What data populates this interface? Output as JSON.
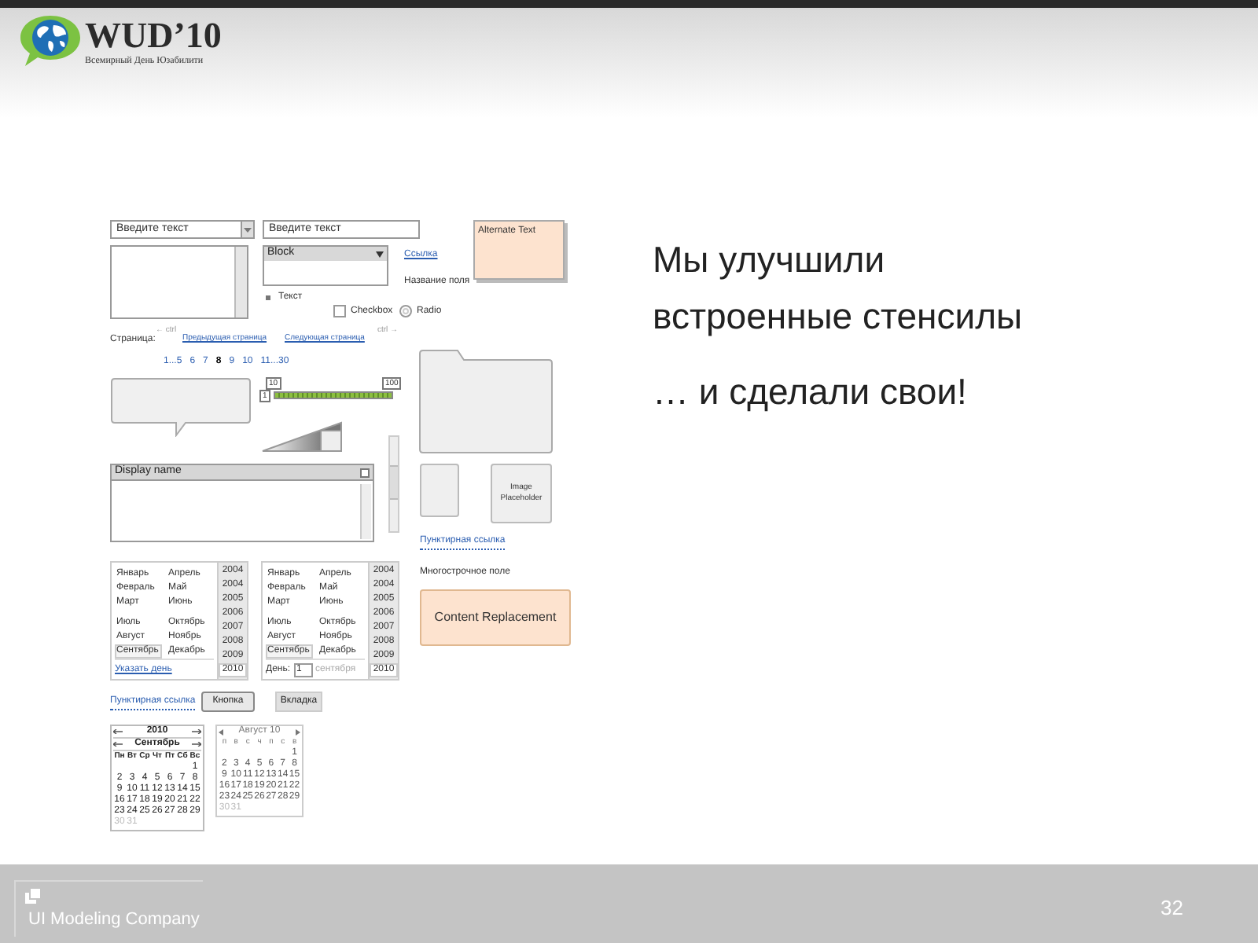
{
  "header": {
    "logo_title": "WUD’10",
    "logo_subtitle": "Всемирный День Юзабилити"
  },
  "slide": {
    "heading_lines": [
      "Мы улучшили",
      "встроенные стенсилы"
    ],
    "tagline": "… и сделали свои!"
  },
  "stencils": {
    "combo": {
      "value": "Введите текст"
    },
    "textbox": {
      "value": "Введите текст"
    },
    "note": "Alternate Text",
    "dropdown": {
      "value": "Block"
    },
    "link": "Ссылка",
    "field_label": "Название поля",
    "bullet": "Текст",
    "checkbox": {
      "label": "Checkbox",
      "checked": false
    },
    "radio": {
      "label": "Radio",
      "selected": false
    },
    "pager": {
      "label": "Страница:",
      "prev_hint": "← ctrl",
      "prev": "Предыдущая страница",
      "next": "Следующая страница",
      "next_hint": "ctrl →",
      "pages": [
        {
          "label": "1...5",
          "selected": false
        },
        {
          "label": "6",
          "selected": false
        },
        {
          "label": "7",
          "selected": false
        },
        {
          "label": "8",
          "selected": true
        },
        {
          "label": "9",
          "selected": false
        },
        {
          "label": "10",
          "selected": false
        },
        {
          "label": "11...30",
          "selected": false
        }
      ]
    },
    "slider": {
      "min": "10",
      "max": "100",
      "value_label": "1",
      "level": 1
    },
    "panel": {
      "title": "Display name"
    },
    "image_placeholder": "Image Placeholder",
    "dotted_link_1": "Пунктирная ссылка",
    "month_pickers": [
      {
        "months": [
          {
            "label": "Январь",
            "selected": false
          },
          {
            "label": "Апрель",
            "selected": false
          },
          {
            "label": "Февраль",
            "selected": false
          },
          {
            "label": "Май",
            "selected": false
          },
          {
            "label": "Март",
            "selected": false
          },
          {
            "label": "Июнь",
            "selected": false
          },
          {
            "label": "Июль",
            "selected": false
          },
          {
            "label": "Октябрь",
            "selected": false
          },
          {
            "label": "Август",
            "selected": false
          },
          {
            "label": "Ноябрь",
            "selected": false
          },
          {
            "label": "Сентябрь",
            "selected": true
          },
          {
            "label": "Декабрь",
            "selected": false
          }
        ],
        "years": [
          {
            "label": "2004",
            "selected": false
          },
          {
            "label": "2004",
            "selected": false
          },
          {
            "label": "2005",
            "selected": false
          },
          {
            "label": "2006",
            "selected": false
          },
          {
            "label": "2007",
            "selected": false
          },
          {
            "label": "2008",
            "selected": false
          },
          {
            "label": "2009",
            "selected": false
          },
          {
            "label": "2010",
            "selected": true
          }
        ],
        "footer": {
          "kind": "link",
          "text": "Указать день"
        }
      },
      {
        "months": [
          {
            "label": "Январь",
            "selected": false
          },
          {
            "label": "Апрель",
            "selected": false
          },
          {
            "label": "Февраль",
            "selected": false
          },
          {
            "label": "Май",
            "selected": false
          },
          {
            "label": "Март",
            "selected": false
          },
          {
            "label": "Июнь",
            "selected": false
          },
          {
            "label": "Июль",
            "selected": false
          },
          {
            "label": "Октябрь",
            "selected": false
          },
          {
            "label": "Август",
            "selected": false
          },
          {
            "label": "Ноябрь",
            "selected": false
          },
          {
            "label": "Сентябрь",
            "selected": true
          },
          {
            "label": "Декабрь",
            "selected": false
          }
        ],
        "years": [
          {
            "label": "2004",
            "selected": false
          },
          {
            "label": "2004",
            "selected": false
          },
          {
            "label": "2005",
            "selected": false
          },
          {
            "label": "2006",
            "selected": false
          },
          {
            "label": "2007",
            "selected": false
          },
          {
            "label": "2008",
            "selected": false
          },
          {
            "label": "2009",
            "selected": false
          },
          {
            "label": "2010",
            "selected": true
          }
        ],
        "footer": {
          "kind": "day",
          "label": "День:",
          "value": "1",
          "month": "сентября"
        }
      }
    ],
    "multiline_label": "Многострочное поле",
    "content_replacement": "Content Replacement",
    "dotted_link_2": "Пунктирная ссылка",
    "button": "Кнопка",
    "tab": "Вкладка",
    "calendars": [
      {
        "kind": "full",
        "year": "2010",
        "month": "Сентябрь",
        "weekdays": [
          "Пн",
          "Вт",
          "Ср",
          "Чт",
          "Пт",
          "Сб",
          "Вс"
        ],
        "weeks": [
          {
            "days": [
              "1"
            ],
            "muted": false
          },
          {
            "days": [
              "2",
              "3",
              "4",
              "5",
              "6",
              "7",
              "8"
            ],
            "muted": false
          },
          {
            "days": [
              "9",
              "10",
              "11",
              "12",
              "13",
              "14",
              "15"
            ],
            "muted": false
          },
          {
            "days": [
              "16",
              "17",
              "18",
              "19",
              "20",
              "21",
              "22"
            ],
            "muted": false
          },
          {
            "days": [
              "23",
              "24",
              "25",
              "26",
              "27",
              "28",
              "29"
            ],
            "muted": false
          },
          {
            "days": [
              "30",
              "31"
            ],
            "muted": true
          }
        ]
      },
      {
        "kind": "compact",
        "month": "Август 10",
        "weekdays": [
          "п",
          "в",
          "с",
          "ч",
          "п",
          "с",
          "в"
        ],
        "weeks": [
          {
            "days": [
              "1"
            ],
            "muted": false
          },
          {
            "days": [
              "2",
              "3",
              "4",
              "5",
              "6",
              "7",
              "8"
            ],
            "muted": false
          },
          {
            "days": [
              "9",
              "10",
              "11",
              "12",
              "13",
              "14",
              "15"
            ],
            "muted": false
          },
          {
            "days": [
              "16",
              "17",
              "18",
              "19",
              "20",
              "21",
              "22"
            ],
            "muted": false
          },
          {
            "days": [
              "23",
              "24",
              "25",
              "26",
              "27",
              "28",
              "29"
            ],
            "muted": false
          },
          {
            "days": [
              "30",
              "31"
            ],
            "muted": true
          }
        ]
      }
    ]
  },
  "footer": {
    "company": "UI Modeling Company",
    "page_number": "32"
  }
}
